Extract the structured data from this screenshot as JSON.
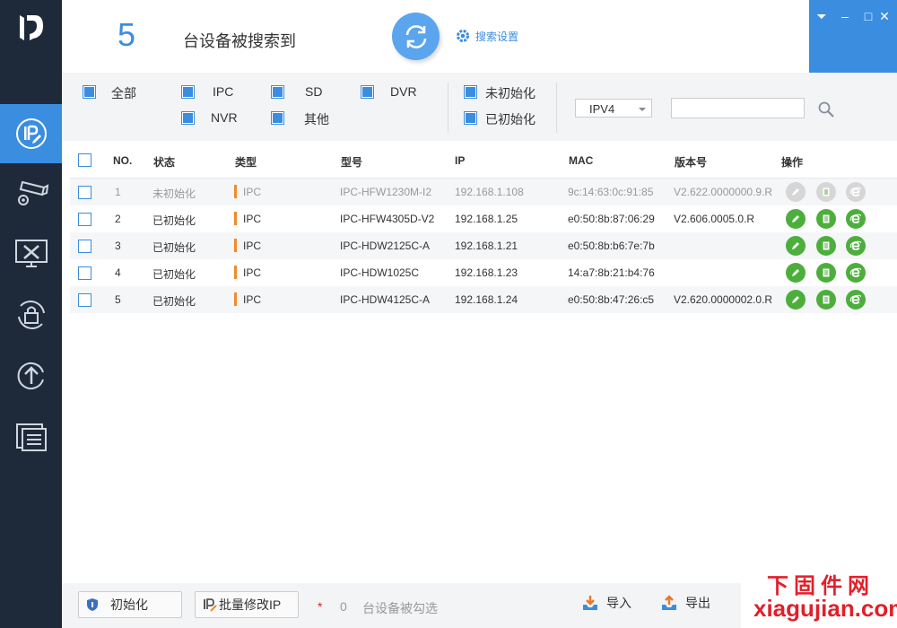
{
  "header": {
    "device_count": "5",
    "found_text": "台设备被搜索到",
    "search_settings_label": "搜索设置"
  },
  "window_controls": {
    "menu": "⏷",
    "minimize": "–",
    "maximize": "□",
    "close": "✕"
  },
  "filters": {
    "type_filters": [
      {
        "label": "全部",
        "checked": true
      },
      {
        "label": "IPC",
        "checked": true
      },
      {
        "label": "SD",
        "checked": true
      },
      {
        "label": "DVR",
        "checked": true
      },
      {
        "label": "NVR",
        "checked": true
      },
      {
        "label": "其他",
        "checked": true
      }
    ],
    "status_filters": [
      {
        "label": "未初始化",
        "checked": true
      },
      {
        "label": "已初始化",
        "checked": true
      }
    ],
    "ip_version": "IPV4",
    "search_value": ""
  },
  "table": {
    "headers": [
      "NO.",
      "状态",
      "类型",
      "型号",
      "IP",
      "MAC",
      "版本号",
      "操作"
    ],
    "rows": [
      {
        "no": "1",
        "status": "未初始化",
        "type": "IPC",
        "model": "IPC-HFW1230M-I2",
        "ip": "192.168.1.108",
        "mac": "9c:14:63:0c:91:85",
        "version": "V2.622.0000000.9.R",
        "enabled": false
      },
      {
        "no": "2",
        "status": "已初始化",
        "type": "IPC",
        "model": "IPC-HFW4305D-V2",
        "ip": "192.168.1.25",
        "mac": "e0:50:8b:87:06:29",
        "version": "V2.606.0005.0.R",
        "enabled": true
      },
      {
        "no": "3",
        "status": "已初始化",
        "type": "IPC",
        "model": "IPC-HDW2125C-A",
        "ip": "192.168.1.21",
        "mac": "e0:50:8b:b6:7e:7b",
        "version": "",
        "enabled": true
      },
      {
        "no": "4",
        "status": "已初始化",
        "type": "IPC",
        "model": "IPC-HDW1025C",
        "ip": "192.168.1.23",
        "mac": "14:a7:8b:21:b4:76",
        "version": "",
        "enabled": true
      },
      {
        "no": "5",
        "status": "已初始化",
        "type": "IPC",
        "model": "IPC-HDW4125C-A",
        "ip": "192.168.1.24",
        "mac": "e0:50:8b:47:26:c5",
        "version": "V2.620.0000002.0.R",
        "enabled": true
      }
    ]
  },
  "bottom": {
    "init_label": "初始化",
    "batch_ip_label": "批量修改IP",
    "asterisk": "*",
    "selected_count": "0",
    "selected_text": "台设备被勾选",
    "import_label": "导入",
    "export_label": "导出"
  },
  "watermark": {
    "line1": "下固件网",
    "line2": "xiagujian.com"
  },
  "colors": {
    "accent": "#3b8de0",
    "sidebar": "#1e2a3a",
    "action_green": "#4caf3c",
    "type_marker": "#f08a2c",
    "watermark": "#e0202a"
  }
}
